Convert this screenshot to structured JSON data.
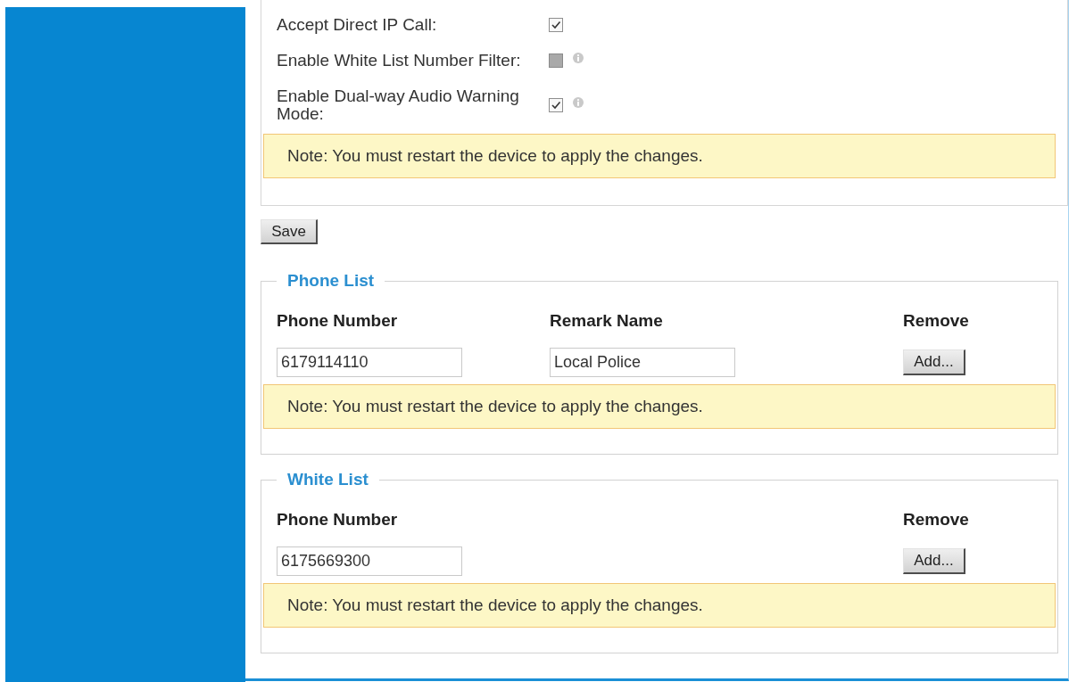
{
  "settings": [
    {
      "label": "Accept Direct IP Call:",
      "checked": true,
      "disabled": false,
      "info": false
    },
    {
      "label": "Enable White List Number Filter:",
      "checked": false,
      "disabled": true,
      "info": true
    },
    {
      "label": "Enable Dual-way Audio Warning Mode:",
      "checked": true,
      "disabled": false,
      "info": true
    }
  ],
  "settings_note": "Note: You must restart the device to apply the changes.",
  "save_button": "Save",
  "lists": [
    {
      "title": "Phone List",
      "columns": [
        {
          "kind": "number",
          "label": "Phone Number"
        },
        {
          "kind": "remark",
          "label": "Remark Name"
        },
        {
          "kind": "action",
          "label": "Remove"
        }
      ],
      "cells": [
        {
          "kind": "number",
          "value": "6179114110"
        },
        {
          "kind": "remark",
          "value": "Local Police"
        },
        {
          "kind": "action",
          "value": "Add..."
        }
      ],
      "note": "Note: You must restart the device to apply the changes."
    },
    {
      "title": "White List",
      "columns": [
        {
          "kind": "number",
          "label": "Phone Number"
        },
        {
          "kind": "action",
          "label": "Remove"
        }
      ],
      "cells": [
        {
          "kind": "number",
          "value": "6175669300"
        },
        {
          "kind": "action",
          "value": "Add..."
        }
      ],
      "note": "Note: You must restart the device to apply the changes."
    }
  ]
}
